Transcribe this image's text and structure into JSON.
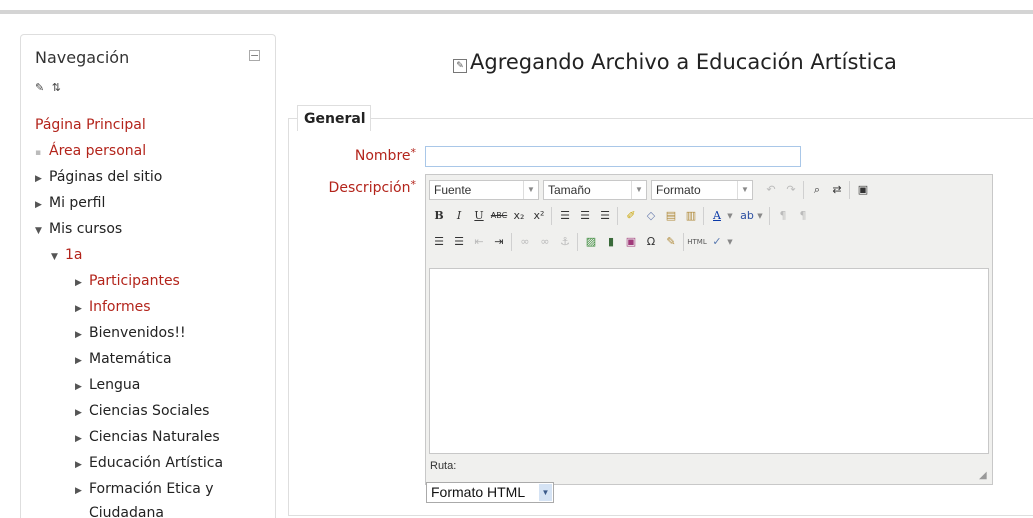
{
  "nav": {
    "title": "Navegación",
    "collapse_symbol": "−",
    "icons": "✎ ⇅",
    "items": [
      {
        "label": "Página Principal",
        "color": "#b3241b"
      },
      {
        "label": "Área personal",
        "color": "#b3241b"
      },
      {
        "label": "Páginas del sitio",
        "color": "#222222"
      },
      {
        "label": "Mi perfil",
        "color": "#222222"
      },
      {
        "label": "Mis cursos",
        "color": "#222222"
      },
      {
        "label": "1a",
        "color": "#b3241b"
      },
      {
        "label": "Participantes",
        "color": "#b3241b"
      },
      {
        "label": "Informes",
        "color": "#b3241b"
      },
      {
        "label": "Bienvenidos!!",
        "color": "#222222"
      },
      {
        "label": "Matemática",
        "color": "#222222"
      },
      {
        "label": "Lengua",
        "color": "#222222"
      },
      {
        "label": "Ciencias Sociales",
        "color": "#222222"
      },
      {
        "label": "Ciencias Naturales",
        "color": "#222222"
      },
      {
        "label": "Educación Artística",
        "color": "#222222"
      },
      {
        "label": "Formación Etica y",
        "color": "#222222"
      },
      {
        "label": "Ciudadana",
        "color": "#222222"
      }
    ]
  },
  "page": {
    "title": "Agregando Archivo a Educación Artística"
  },
  "form": {
    "legend": "General",
    "name_label": "Nombre",
    "name_value": "",
    "description_label": "Descripción",
    "required_mark": "*",
    "format_value": "Formato HTML"
  },
  "editor": {
    "font_select": "Fuente",
    "size_select": "Tamaño",
    "format_select": "Formato",
    "path_label": "Ruta:"
  }
}
